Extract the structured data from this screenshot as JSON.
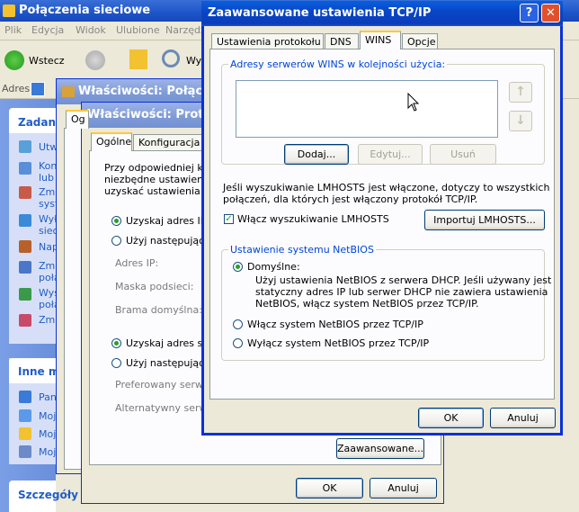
{
  "explorer": {
    "title": "Połączenia sieciowe",
    "menu": [
      "Plik",
      "Edycja",
      "Widok",
      "Ulubione",
      "Narzędz"
    ],
    "back_label": "Wstecz",
    "search_label": "Wys",
    "address_label": "Adres",
    "task_pane": {
      "tasks_header": "Zadania",
      "task_items": [
        "Utw",
        "Kon lub",
        "Zmi syst",
        "Wył siec",
        "Nap",
        "Zmi poła",
        "Wys poła",
        "Zmi"
      ],
      "other_header": "Inne m",
      "other_items": [
        "Pan",
        "Moj",
        "Moj",
        "Moj"
      ],
      "details_header": "Szczegóły"
    }
  },
  "props_win": {
    "title": "Właściwości: Połączen",
    "tab": "Og"
  },
  "tcp_props_win": {
    "title": "Właściwości: Protoko",
    "tabs": [
      "Ogólne",
      "Konfiguracja al"
    ],
    "description": [
      "Przy odpowiedniej konf",
      "niezbędne ustawienia p",
      "uzyskać ustawienia pro"
    ],
    "auto_ip": "Uzyskaj adres IP a",
    "use_ip": "Użyj następująceg",
    "ip_label": "Adres IP:",
    "mask_label": "Maska podsieci:",
    "gateway_label": "Brama domyślna:",
    "auto_dns": "Uzyskaj adres ser",
    "use_dns": "Użyj następującyc",
    "preferred_dns": "Preferowany serwer",
    "alternate_dns": "Alternatywny serwer",
    "advanced_button": "Zaawansowane...",
    "ok_button": "OK",
    "cancel_button": "Anuluj"
  },
  "advanced_win": {
    "title": "Zaawansowane ustawienia TCP/IP",
    "tabs": [
      "Ustawienia protokołu IP",
      "DNS",
      "WINS",
      "Opcje"
    ],
    "selected_tab": "WINS",
    "wins_group_label": "Adresy serwerów WINS w kolejności użycia:",
    "add_button": "Dodaj...",
    "edit_button": "Edytuj...",
    "remove_button": "Usuń",
    "lmhosts_info": [
      "Jeśli wyszukiwanie LMHOSTS jest włączone, dotyczy to wszystkich",
      "połączeń, dla których jest włączony protokół TCP/IP."
    ],
    "lmhosts_checkbox": "Włącz wyszukiwanie LMHOSTS",
    "lmhosts_checked": true,
    "import_button": "Importuj LMHOSTS...",
    "netbios_group_label": "Ustawienie systemu NetBIOS",
    "netbios_default": "Domyślne:",
    "netbios_default_desc": [
      "Użyj ustawienia NetBIOS z serwera DHCP. Jeśli używany jest",
      "statyczny adres IP lub serwer DHCP nie zawiera ustawienia",
      "NetBIOS, włącz system NetBIOS przez TCP/IP."
    ],
    "netbios_enable": "Włącz system NetBIOS przez TCP/IP",
    "netbios_disable": "Wyłącz system NetBIOS przez TCP/IP",
    "selected_netbios": "Domyślne:",
    "ok_button": "OK",
    "cancel_button": "Anuluj"
  }
}
